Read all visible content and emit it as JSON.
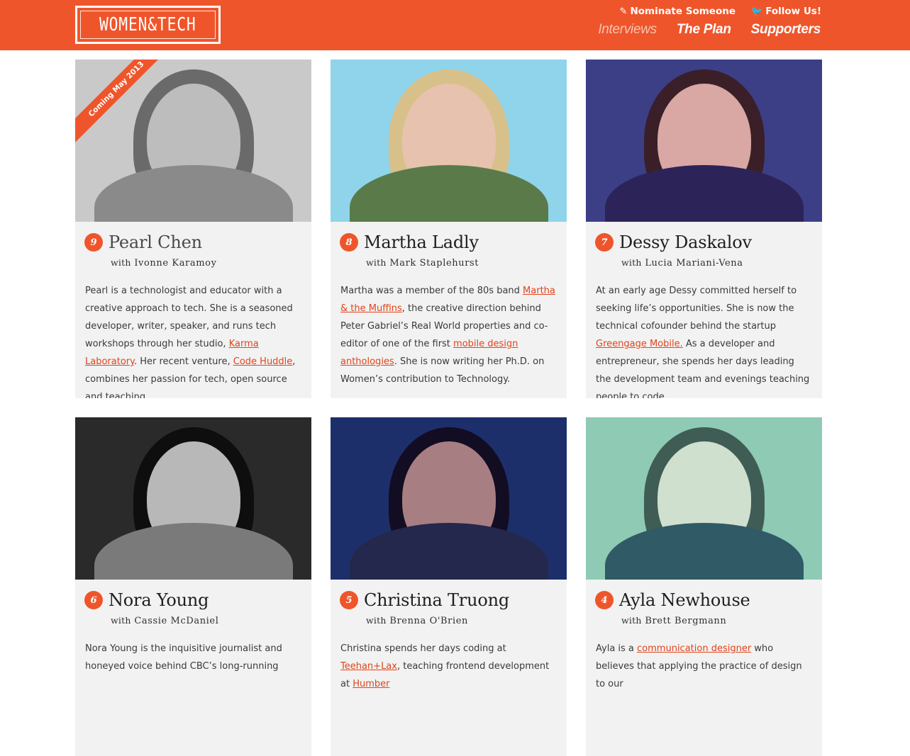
{
  "header": {
    "logo_text": "WOMEN&TECH",
    "util_links": [
      {
        "icon": "pencil-icon",
        "glyph": "✎",
        "label": "Nominate Someone"
      },
      {
        "icon": "twitter-icon",
        "glyph": "🐦",
        "label": "Follow Us!"
      }
    ],
    "nav": [
      {
        "label": "Interviews",
        "active": true
      },
      {
        "label": "The Plan",
        "active": false
      },
      {
        "label": "Supporters",
        "active": false
      }
    ]
  },
  "colors": {
    "accent": "#ef552b",
    "link": "#e1431a",
    "card_bg": "#f2f2f2"
  },
  "with_prefix": "with",
  "cards": [
    {
      "number": "9",
      "name": "Pearl Chen",
      "interviewer": "Ivonne Karamoy",
      "ribbon": "Coming May 2013",
      "faded": true,
      "photo": {
        "bg": "#c9c9c9",
        "hair": "#6a6a6a",
        "head": "#bdbdbd",
        "body": "#8a8a8a"
      },
      "bio": [
        {
          "t": "Pearl is a technologist and educator with a creative  approach to tech. She is a seasoned developer, writer, speaker, and runs tech workshops through her studio, "
        },
        {
          "t": "Karma Laboratory",
          "link": true
        },
        {
          "t": ". Her recent venture, "
        },
        {
          "t": "Code Huddle",
          "link": true
        },
        {
          "t": ", combines her passion for tech, open source and teaching."
        }
      ]
    },
    {
      "number": "8",
      "name": "Martha Ladly",
      "interviewer": "Mark Staplehurst",
      "photo": {
        "bg": "#8fd4ea",
        "hair": "#d8c08a",
        "head": "#e7c2ae",
        "body": "#5a7a4a"
      },
      "bio": [
        {
          "t": "Martha was a member of the 80s band "
        },
        {
          "t": "Martha & the Muffins",
          "link": true
        },
        {
          "t": ", the creative direction behind Peter Gabriel’s Real World properties and co-editor of one of the first "
        },
        {
          "t": "mobile design anthologies",
          "link": true
        },
        {
          "t": ". She is now writing her Ph.D. on Women’s contribution to Technology."
        }
      ]
    },
    {
      "number": "7",
      "name": "Dessy Daskalov",
      "interviewer": "Lucia Mariani-Vena",
      "photo": {
        "bg": "#3c3f86",
        "hair": "#3a1f28",
        "head": "#d9a7a4",
        "body": "#2c2458"
      },
      "bio": [
        {
          "t": "At an early age Dessy committed herself to seeking life’s opportunities. She is now the technical cofounder behind the startup "
        },
        {
          "t": "Greengage Mobile.",
          "link": true
        },
        {
          "t": " As a developer and entrepreneur, she spends her days leading the development team and evenings teaching people to code."
        }
      ]
    },
    {
      "number": "6",
      "name": "Nora Young",
      "interviewer": "Cassie McDaniel",
      "photo": {
        "bg": "#2a2a2a",
        "hair": "#0e0e0e",
        "head": "#b8b8b8",
        "body": "#7a7a7a"
      },
      "bio": [
        {
          "t": "Nora Young is the inquisitive journalist and honeyed voice behind CBC’s long-running"
        }
      ]
    },
    {
      "number": "5",
      "name": "Christina Truong",
      "interviewer": "Brenna O'Brien",
      "photo": {
        "bg": "#1d2f6b",
        "hair": "#120d22",
        "head": "#a77e82",
        "body": "#23284c"
      },
      "bio": [
        {
          "t": "Christina spends her days coding at "
        },
        {
          "t": "Teehan+Lax",
          "link": true
        },
        {
          "t": ", teaching frontend development at "
        },
        {
          "t": "Humber",
          "link": true
        }
      ]
    },
    {
      "number": "4",
      "name": "Ayla Newhouse",
      "interviewer": "Brett Bergmann",
      "photo": {
        "bg": "#8fcab4",
        "hair": "#3f5c55",
        "head": "#cfe0cf",
        "body": "#2f5a66"
      },
      "bio": [
        {
          "t": "Ayla is a "
        },
        {
          "t": "communication designer",
          "link": true
        },
        {
          "t": " who believes that applying the practice of design to our"
        }
      ]
    }
  ]
}
